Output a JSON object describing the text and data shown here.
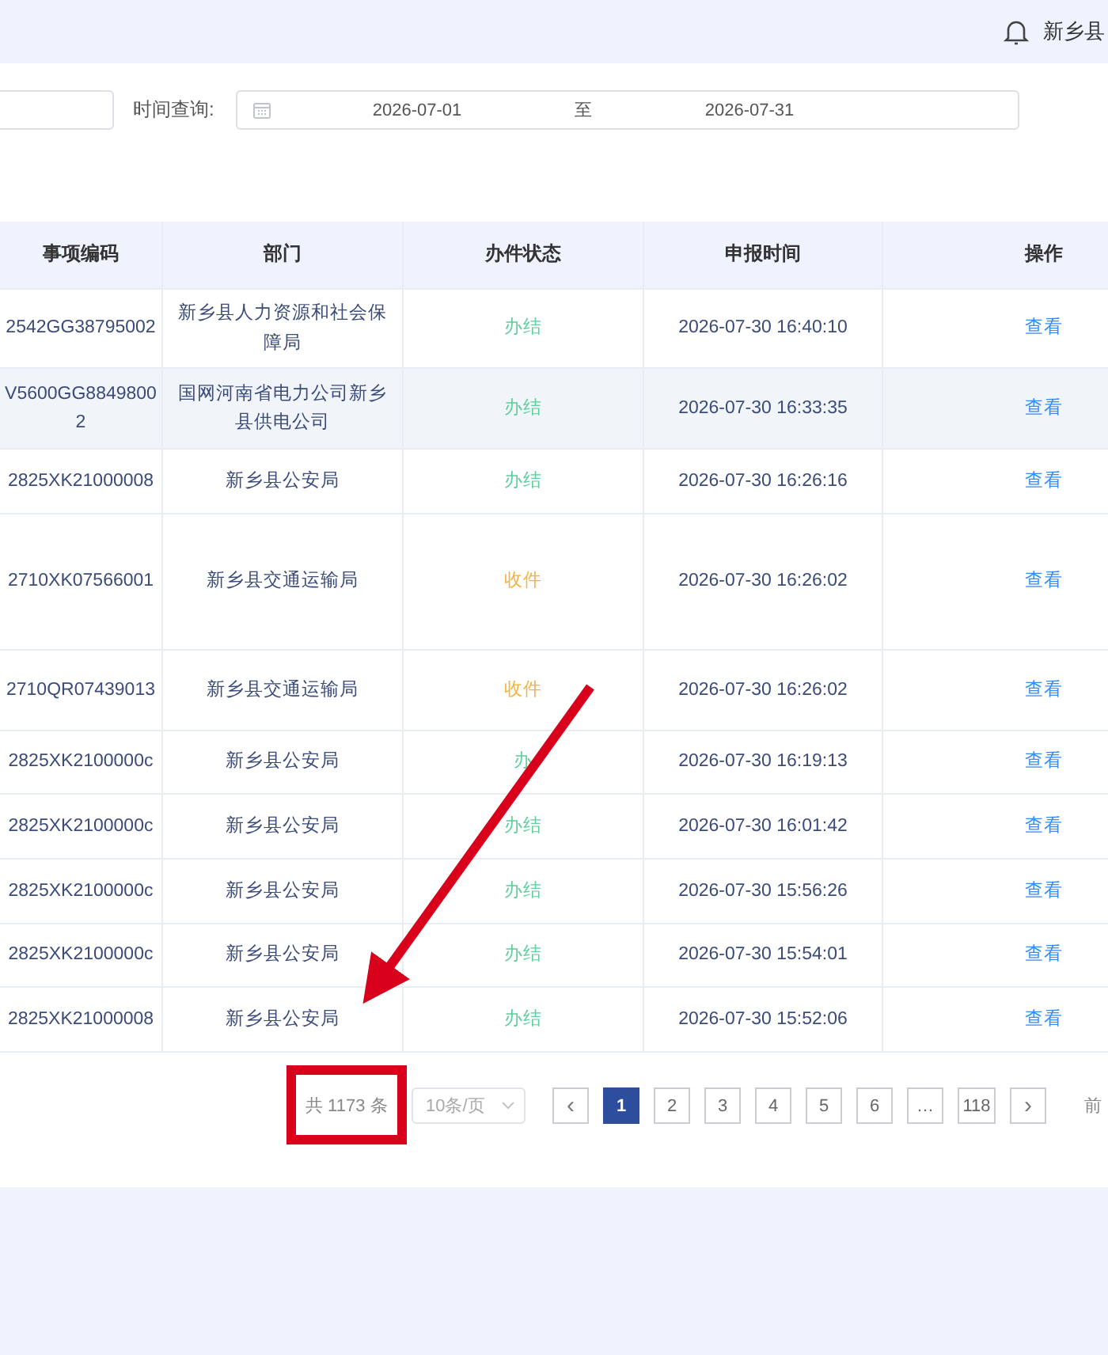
{
  "header": {
    "user_name": "新乡县"
  },
  "filters": {
    "time_label": "时间查询:",
    "start_date": "2026-07-01",
    "range_separator": "至",
    "end_date": "2026-07-31"
  },
  "table": {
    "columns": [
      "事项编码",
      "部门",
      "办件状态",
      "申报时间",
      "操作"
    ],
    "rows": [
      {
        "code": "2542GG38795002",
        "department": "新乡县人力资源和社会保障局",
        "status": {
          "text": "办结",
          "color": "#5fcf9b"
        },
        "time": "2026-07-30 16:40:10",
        "action": "查看",
        "striped": false
      },
      {
        "code": "V5600GG88498002",
        "department": "国网河南省电力公司新乡县供电公司",
        "status": {
          "text": "办结",
          "color": "#5fcf9b"
        },
        "time": "2026-07-30 16:33:35",
        "action": "查看",
        "striped": true
      },
      {
        "code": "2825XK21000008",
        "department": "新乡县公安局",
        "status": {
          "text": "办结",
          "color": "#5fcf9b"
        },
        "time": "2026-07-30 16:26:16",
        "action": "查看",
        "striped": false
      },
      {
        "code": "2710XK07566001",
        "department": "新乡县交通运输局",
        "status": {
          "text": "收件",
          "color": "#f6b23c"
        },
        "time": "2026-07-30 16:26:02",
        "action": "查看",
        "striped": false
      },
      {
        "code": "2710QR07439013",
        "department": "新乡县交通运输局",
        "status": {
          "text": "收件",
          "color": "#f6b23c"
        },
        "time": "2026-07-30 16:26:02",
        "action": "查看",
        "striped": false
      },
      {
        "code": "2825XK2100000c",
        "department": "新乡县公安局",
        "status": {
          "text": "办",
          "color": "#5fcf9b"
        },
        "time": "2026-07-30 16:19:13",
        "action": "查看",
        "striped": false
      },
      {
        "code": "2825XK2100000c",
        "department": "新乡县公安局",
        "status": {
          "text": "办结",
          "color": "#5fcf9b"
        },
        "time": "2026-07-30 16:01:42",
        "action": "查看",
        "striped": false
      },
      {
        "code": "2825XK2100000c",
        "department": "新乡县公安局",
        "status": {
          "text": "办结",
          "color": "#5fcf9b"
        },
        "time": "2026-07-30 15:56:26",
        "action": "查看",
        "striped": false
      },
      {
        "code": "2825XK2100000c",
        "department": "新乡县公安局",
        "status": {
          "text": "办结",
          "color": "#5fcf9b"
        },
        "time": "2026-07-30 15:54:01",
        "action": "查看",
        "striped": false
      },
      {
        "code": "2825XK21000008",
        "department": "新乡县公安局",
        "status": {
          "text": "办结",
          "color": "#5fcf9b"
        },
        "time": "2026-07-30 15:52:06",
        "action": "查看",
        "striped": false
      }
    ]
  },
  "pagination": {
    "total": "共 1173 条",
    "page_size": "10条/页",
    "prev": "‹",
    "next": "›",
    "jump_label": "前",
    "pages": [
      {
        "label": "1",
        "selected": true
      },
      {
        "label": "2",
        "selected": false
      },
      {
        "label": "3",
        "selected": false
      },
      {
        "label": "4",
        "selected": false
      },
      {
        "label": "5",
        "selected": false
      },
      {
        "label": "6",
        "selected": false
      },
      {
        "label": "…",
        "selected": false
      },
      {
        "label": "118",
        "selected": false
      }
    ]
  }
}
